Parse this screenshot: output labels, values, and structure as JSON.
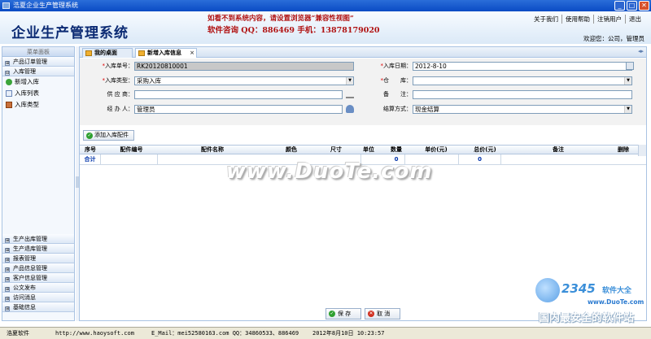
{
  "window": {
    "title": "浩夏企业生产管理系统"
  },
  "header": {
    "app_title": "企业生产管理系统",
    "notice": "如看不到系统内容，请设置浏览器“兼容性视图”",
    "contact": "软件咨询 QQ：886469 手机：13878179020",
    "links": [
      "关于我们",
      "使用帮助",
      "注销用户",
      "退出"
    ],
    "welcome": "欢迎您：公司，管理员"
  },
  "sidebar": {
    "panel_title": "菜单面板",
    "sections_top": [
      {
        "label": "产品订单管理",
        "sign": "⊞"
      },
      {
        "label": "入库管理",
        "sign": "⊟"
      }
    ],
    "items": [
      {
        "label": "新增入库",
        "icon": "add-icon"
      },
      {
        "label": "入库列表",
        "icon": "list-icon"
      },
      {
        "label": "入库类型",
        "icon": "folder-icon"
      }
    ],
    "sections_bottom": [
      {
        "label": "生产出库管理",
        "sign": "⊞"
      },
      {
        "label": "生产退库管理",
        "sign": "⊞"
      },
      {
        "label": "报表管理",
        "sign": "⊞"
      },
      {
        "label": "产品信息管理",
        "sign": "⊞"
      },
      {
        "label": "客户信息管理",
        "sign": "⊞"
      },
      {
        "label": "公文发布",
        "sign": "⊞"
      },
      {
        "label": "访问消息",
        "sign": "⊞"
      },
      {
        "label": "基础信息",
        "sign": "⊞"
      }
    ]
  },
  "tabs": [
    {
      "label": "我的桌面"
    },
    {
      "label": "新增入库信息",
      "close": "×"
    }
  ],
  "tab_scroll": "◂▸",
  "form": {
    "bill_no": {
      "label": "入库单号：",
      "value": "RK20120810001"
    },
    "bill_date": {
      "label": "入库日期：",
      "value": "2012-8-10"
    },
    "bill_type": {
      "label": "入库类型：",
      "value": "采购入库"
    },
    "warehouse": {
      "label": "仓　　库：",
      "value": ""
    },
    "supplier": {
      "label": "供 应 商：",
      "value": ""
    },
    "remark": {
      "label": "备　　注：",
      "value": ""
    },
    "handler": {
      "label": "经 办 人：",
      "value": "管理员"
    },
    "settlement": {
      "label": "结算方式：",
      "value": "现金结算"
    },
    "required_mark": "*",
    "dropdown_arrow": "▼"
  },
  "add_button": {
    "label": "添加入库配件",
    "icon": "✓"
  },
  "grid": {
    "columns": [
      "序号",
      "配件编号",
      "配件名称",
      "颜色",
      "尺寸",
      "单位",
      "数量",
      "单价(元)",
      "总价(元)",
      "备注",
      "删除"
    ],
    "total_row": {
      "label": "合计",
      "qty": "0",
      "total": "0"
    }
  },
  "actions": {
    "save": "保 存",
    "cancel": "取 消",
    "save_icon": "✓",
    "cancel_icon": "✕"
  },
  "watermark": "www.DuoTe.com",
  "statusbar": {
    "company": "浩夏软件",
    "url": "http://www.haoysoft.com",
    "email": "E_Mail：mei52580163.com  QQ：34860533、886469",
    "datetime": "2012年8月10日 10:23:57"
  },
  "logo": {
    "brand": "2345",
    "brand_suffix": "软件大全",
    "url": "www.DuoTe.com",
    "slogan": "国内最安全的软件站"
  },
  "colors": {
    "accent": "#0a4bc4",
    "title": "#0b2a73",
    "notice": "#b01010"
  }
}
